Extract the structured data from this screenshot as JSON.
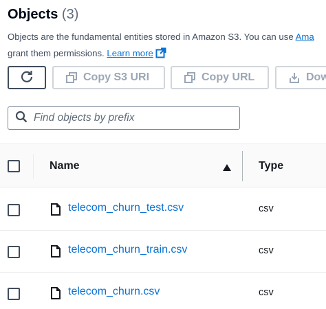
{
  "header": {
    "title": "Objects",
    "count": "(3)",
    "description_line1": "Objects are the fundamental entities stored in Amazon S3. You can use",
    "description_link1": "Ama",
    "description_line2": "grant them permissions.",
    "learn_more": "Learn more"
  },
  "toolbar": {
    "refresh_icon": "refresh-icon",
    "copy_s3_uri": "Copy S3 URI",
    "copy_url": "Copy URL",
    "download": "Dow"
  },
  "search": {
    "placeholder": "Find objects by prefix"
  },
  "table": {
    "columns": [
      "Name",
      "Type"
    ],
    "sort": "ascending",
    "rows": [
      {
        "name": "telecom_churn_test.csv",
        "type": "csv"
      },
      {
        "name": "telecom_churn_train.csv",
        "type": "csv"
      },
      {
        "name": "telecom_churn.csv",
        "type": "csv"
      }
    ]
  },
  "colors": {
    "link": "#0972d3",
    "text": "#16191f",
    "disabled": "#9ba7b6",
    "border": "#d1d5db"
  }
}
